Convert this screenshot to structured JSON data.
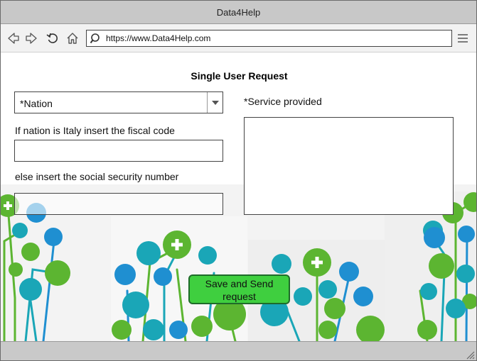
{
  "window": {
    "title": "Data4Help"
  },
  "toolbar": {
    "url": "https://www.Data4Help.com",
    "icons": [
      "back-icon",
      "forward-icon",
      "reload-icon",
      "home-icon",
      "search-icon",
      "hamburger-menu-icon"
    ]
  },
  "form": {
    "title": "Single User Request",
    "nation_select": {
      "selected": "*Nation"
    },
    "fiscal_code_label": "If nation is Italy insert the fiscal code",
    "fiscal_code_value": "",
    "ssn_label": "else insert the social security number",
    "ssn_value": "",
    "service_label": "*Service provided",
    "service_value": "",
    "submit_label": "Save and Send request"
  },
  "colors": {
    "titlebar": "#c8c8c8",
    "button_green": "#3fcf3f",
    "button_border": "#1f6b2a",
    "tree_green": "#5cb531",
    "tree_teal": "#1aa6b7",
    "tree_blue": "#1f8fd1"
  }
}
